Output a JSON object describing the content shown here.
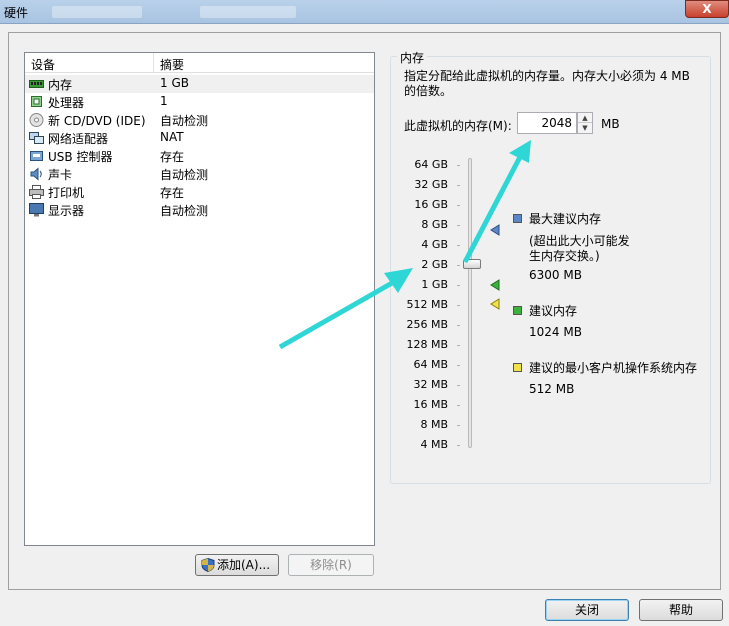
{
  "window": {
    "title": "硬件",
    "close_label": "X"
  },
  "device_list": {
    "columns": [
      "设备",
      "摘要"
    ],
    "rows": [
      {
        "name": "内存",
        "summary": "1 GB",
        "icon": "memory-icon"
      },
      {
        "name": "处理器",
        "summary": "1",
        "icon": "processor-icon"
      },
      {
        "name": "新 CD/DVD (IDE)",
        "summary": "自动检测",
        "icon": "cd-dvd-icon"
      },
      {
        "name": "网络适配器",
        "summary": "NAT",
        "icon": "network-adapter-icon"
      },
      {
        "name": "USB 控制器",
        "summary": "存在",
        "icon": "usb-icon"
      },
      {
        "name": "声卡",
        "summary": "自动检测",
        "icon": "sound-card-icon"
      },
      {
        "name": "打印机",
        "summary": "存在",
        "icon": "printer-icon"
      },
      {
        "name": "显示器",
        "summary": "自动检测",
        "icon": "display-icon"
      }
    ]
  },
  "buttons": {
    "add": "添加(A)...",
    "remove": "移除(R)",
    "close": "关闭",
    "help": "帮助"
  },
  "memory": {
    "group_title": "内存",
    "description": "指定分配给此虚拟机的内存量。内存大小必须为 4 MB 的倍数。",
    "field_label": "此虚拟机的内存(M):",
    "value": "2048",
    "unit": "MB",
    "scale": [
      "64 GB",
      "32 GB",
      "16 GB",
      "8 GB",
      "4 GB",
      "2 GB",
      "1 GB",
      "512 MB",
      "256 MB",
      "128 MB",
      "64 MB",
      "32 MB",
      "16 MB",
      "8 MB",
      "4 MB"
    ],
    "slider_value": "2 GB",
    "legend": {
      "max_title": "最大建议内存",
      "max_note": "(超出此大小可能发生内存交换。)",
      "max_value": "6300 MB",
      "rec_title": "建议内存",
      "rec_value": "1024 MB",
      "min_title": "建议的最小客户机操作系统内存",
      "min_value": "512 MB"
    },
    "colors": {
      "max": "#5b87c8",
      "rec": "#3cb23c",
      "min": "#f2e24a",
      "annotation_arrow": "#2fd6d6"
    }
  }
}
